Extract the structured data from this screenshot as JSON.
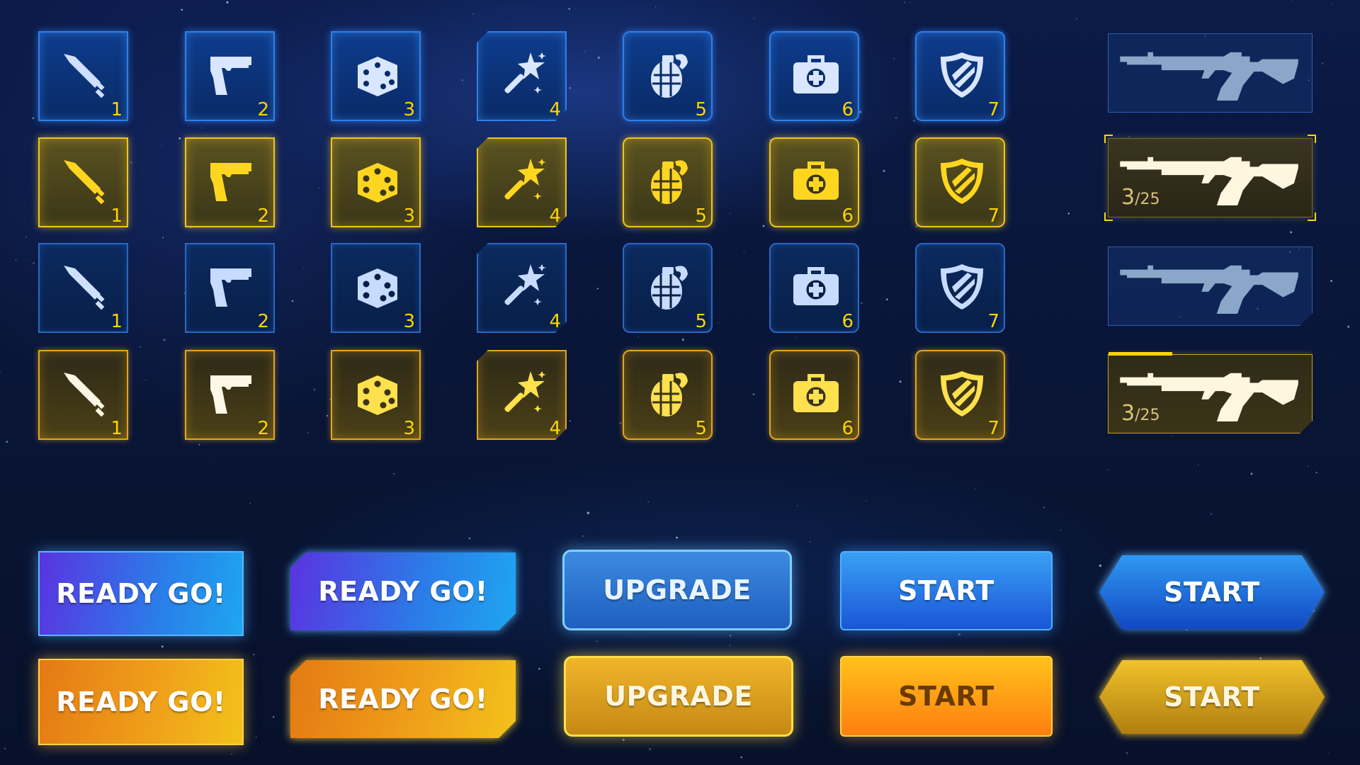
{
  "slot_rows": [
    {
      "style": "blue-glow"
    },
    {
      "style": "gold-selected"
    },
    {
      "style": "blue-dim"
    },
    {
      "style": "gold-dark"
    }
  ],
  "slots": [
    {
      "icon": "sword-icon",
      "number": "1"
    },
    {
      "icon": "pistol-icon",
      "number": "2"
    },
    {
      "icon": "dice-icon",
      "number": "3"
    },
    {
      "icon": "magic-wand-icon",
      "number": "4"
    },
    {
      "icon": "grenade-icon",
      "number": "5"
    },
    {
      "icon": "medkit-icon",
      "number": "6"
    },
    {
      "icon": "shield-icon",
      "number": "7"
    }
  ],
  "weapon_cards": [
    {
      "icon": "assault-rifle-icon",
      "count": "",
      "count_max": ""
    },
    {
      "icon": "assault-rifle-icon",
      "count": "3",
      "count_max": "/25"
    },
    {
      "icon": "assault-rifle-icon",
      "count": "",
      "count_max": ""
    },
    {
      "icon": "assault-rifle-icon",
      "count": "3",
      "count_max": "/25"
    }
  ],
  "buttons": {
    "ready_go": "READY GO!",
    "upgrade": "UPGRADE",
    "start": "START"
  },
  "colors": {
    "accent_blue": "#2f7fe8",
    "accent_gold": "#ffd400",
    "background": "#0a1638"
  }
}
